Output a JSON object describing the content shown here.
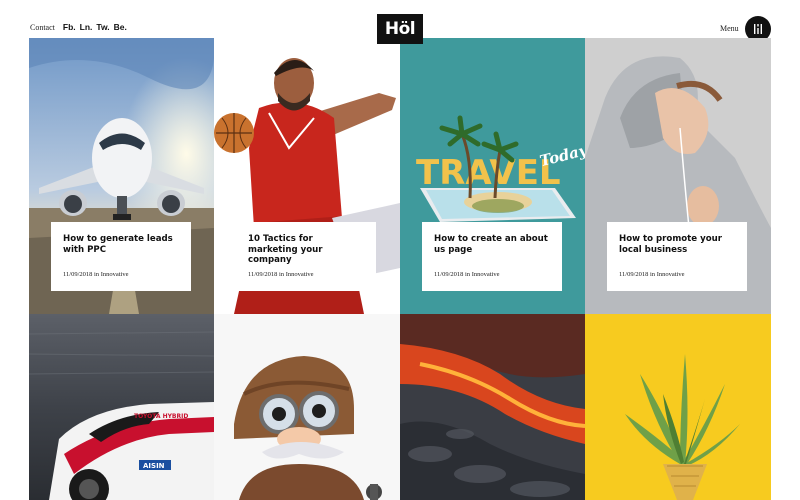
{
  "header": {
    "contact": "Contact",
    "socials": [
      "Fb.",
      "Ln.",
      "Tw.",
      "Be."
    ],
    "logo": "Höl",
    "menu": "Menu",
    "menu_icon": "menu-dots-icon"
  },
  "posts": [
    {
      "title": "How to generate leads with PPC",
      "date": "11/09/2018",
      "in": "in",
      "category": "Innovative",
      "image": "airplane-photo"
    },
    {
      "title": "10 Tactics for marketing your company",
      "date": "11/09/2018",
      "in": "in",
      "category": "Innovative",
      "image": "basketball-player-photo"
    },
    {
      "title": "How to create an about us page",
      "date": "11/09/2018",
      "in": "in",
      "category": "Innovative",
      "image": "travel-phone-illustration",
      "image_text": [
        "TRAVEL",
        "Today"
      ]
    },
    {
      "title": "How to promote your local business",
      "date": "11/09/2018",
      "in": "in",
      "category": "Innovative",
      "image": "woman-hoodie-photo"
    }
  ],
  "bottom_tiles": [
    {
      "image": "race-car-photo",
      "image_text": [
        "TOYOTA HYBRID",
        "AISIN"
      ]
    },
    {
      "image": "aviator-character-illustration"
    },
    {
      "image": "lava-field-photo"
    },
    {
      "image": "pineapple-photo"
    }
  ],
  "colors": {
    "accent": "#111111",
    "background": "#ffffff",
    "teal": "#3f9a9c",
    "yellow": "#f7cb1f"
  }
}
